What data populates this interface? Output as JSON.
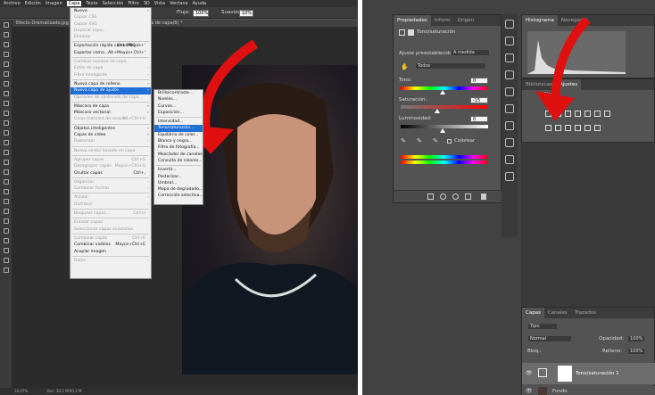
{
  "left": {
    "menubar": [
      "Archivo",
      "Edición",
      "Imagen",
      "Capa",
      "Texto",
      "Selección",
      "Filtro",
      "3D",
      "Vista",
      "Ventana",
      "Ayuda"
    ],
    "options": {
      "flujo": "Flujo:",
      "flujo_val": "100%",
      "suavizar": "Suavizar:",
      "suav_val": "10%"
    },
    "doc_tab": "Efecto Dramatizado.jpg al 16,7% (Tono/saturación 1, Máscara de capa/8) *",
    "status": {
      "zoom": "16,67%",
      "doc": "Doc: 30,2 M/30,2 M"
    },
    "capa_menu": [
      {
        "label": "Nueva",
        "arrow": "›"
      },
      {
        "label": "Copiar CSS",
        "disabled": true
      },
      {
        "label": "Copiar SVG",
        "disabled": true
      },
      {
        "label": "Duplicar capa...",
        "disabled": true
      },
      {
        "label": "Eliminar",
        "disabled": true
      },
      {
        "sep": true
      },
      {
        "label": "Exportación rápida como PNG",
        "sc": "Ctrl+Mayús+'"
      },
      {
        "label": "Exportar como...",
        "sc": "Alt+Mayús+Ctrl+'"
      },
      {
        "sep": true
      },
      {
        "label": "Cambiar nombre de capa...",
        "disabled": true
      },
      {
        "label": "Estilo de capa",
        "arrow": "›",
        "disabled": true
      },
      {
        "label": "Filtro inteligente",
        "arrow": "›",
        "disabled": true
      },
      {
        "sep": true
      },
      {
        "label": "Nueva capa de relleno",
        "arrow": "›"
      },
      {
        "label": "Nueva capa de ajuste",
        "arrow": "›",
        "hl": true
      },
      {
        "label": "Opciones de contenido de capa...",
        "disabled": true
      },
      {
        "sep": true
      },
      {
        "label": "Máscara de capa",
        "arrow": "›"
      },
      {
        "label": "Máscara vectorial",
        "arrow": "›"
      },
      {
        "label": "Crear máscara de recorte",
        "sc": "Alt+Ctrl+G",
        "disabled": true
      },
      {
        "sep": true
      },
      {
        "label": "Objetos inteligentes",
        "arrow": "›"
      },
      {
        "label": "Capas de vídeo",
        "arrow": "›"
      },
      {
        "label": "Rasterizar",
        "arrow": "›",
        "disabled": true
      },
      {
        "sep": true
      },
      {
        "label": "Nuevo sector basado en capa",
        "disabled": true
      },
      {
        "sep": true
      },
      {
        "label": "Agrupar capas",
        "sc": "Ctrl+G",
        "disabled": true
      },
      {
        "label": "Desagrupar capas",
        "sc": "Mayús+Ctrl+G",
        "disabled": true
      },
      {
        "label": "Ocultar capas",
        "sc": "Ctrl+,"
      },
      {
        "sep": true
      },
      {
        "label": "Organizar",
        "arrow": "›",
        "disabled": true
      },
      {
        "label": "Combinar formas",
        "arrow": "›",
        "disabled": true
      },
      {
        "sep": true
      },
      {
        "label": "Alinear",
        "arrow": "›",
        "disabled": true
      },
      {
        "label": "Distribuir",
        "arrow": "›",
        "disabled": true
      },
      {
        "sep": true
      },
      {
        "label": "Bloquear capas...",
        "sc": "Ctrl+/",
        "disabled": true
      },
      {
        "sep": true
      },
      {
        "label": "Enlazar capas",
        "disabled": true
      },
      {
        "label": "Seleccionar capas enlazadas",
        "disabled": true
      },
      {
        "sep": true
      },
      {
        "label": "Combinar capas",
        "sc": "Ctrl+E",
        "disabled": true
      },
      {
        "label": "Combinar visibles",
        "sc": "Mayús+Ctrl+E"
      },
      {
        "label": "Acoplar imagen"
      },
      {
        "sep": true
      },
      {
        "label": "Halos",
        "arrow": "›",
        "disabled": true
      }
    ],
    "sub_menu": [
      {
        "label": "Brillo/contraste..."
      },
      {
        "label": "Niveles..."
      },
      {
        "label": "Curvas..."
      },
      {
        "label": "Exposición..."
      },
      {
        "sep": true
      },
      {
        "label": "Intensidad..."
      },
      {
        "label": "Tono/saturación...",
        "hl": true
      },
      {
        "label": "Equilibrio de color..."
      },
      {
        "label": "Blanco y negro..."
      },
      {
        "label": "Filtro de fotografía..."
      },
      {
        "label": "Mezclador de canales..."
      },
      {
        "label": "Consulta de colores..."
      },
      {
        "sep": true
      },
      {
        "label": "Invertir..."
      },
      {
        "label": "Posterizar..."
      },
      {
        "label": "Umbral..."
      },
      {
        "label": "Mapa de degradado..."
      },
      {
        "label": "Corrección selectiva..."
      }
    ]
  },
  "right": {
    "props_tabs": [
      "Propiedades",
      "Inform",
      "Origen"
    ],
    "props_title": "Tono/saturación",
    "preset_label": "Ajuste preestablecido:",
    "preset_value": "A medida",
    "channel": "Todos",
    "hue_label": "Tono:",
    "hue_value": "0",
    "sat_label": "Saturación:",
    "sat_value": "-15",
    "light_label": "Luminosidad:",
    "light_value": "0",
    "colorize_label": "Colorear",
    "histo_tabs": [
      "Histograma",
      "Navegador"
    ],
    "adj_tabs": [
      "Bibliotecas",
      "Ajustes"
    ],
    "adj_title": "Ajuste",
    "layers_tabs": [
      "Capas",
      "Canales",
      "Trazados"
    ],
    "kind": "Tipo",
    "blend": "Normal",
    "opacity_label": "Opacidad:",
    "opacity_value": "100%",
    "lock_label": "Bloq.:",
    "fill_label": "Relleno:",
    "fill_value": "100%",
    "layer1": "Tono/saturación 1",
    "layer2": "Fondo",
    "accent_red": "#e01010"
  }
}
